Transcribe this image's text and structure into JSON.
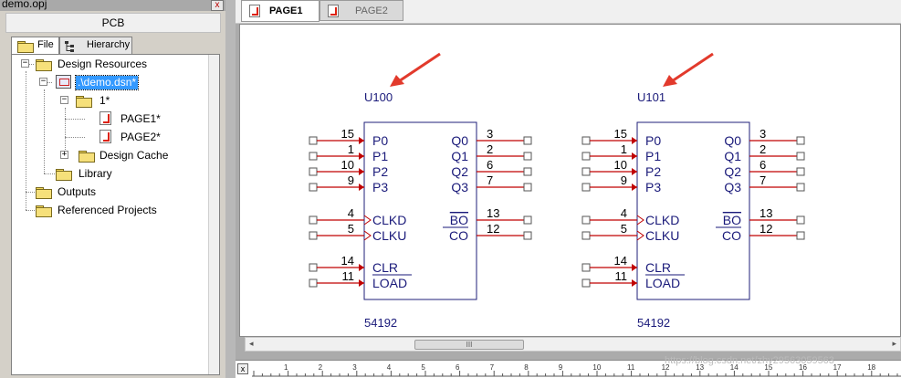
{
  "project": {
    "window_title": "demo.opj",
    "close_glyph": "x",
    "category": "PCB",
    "tabs": [
      {
        "label": "File",
        "icon": "folder-icon"
      },
      {
        "label": "Hierarchy",
        "icon": "hierarchy-icon"
      }
    ],
    "tree": {
      "design_resources": "Design Resources",
      "dsn": ".\\demo.dsn*",
      "schematic_folder": "1*",
      "page1": "PAGE1*",
      "page2": "PAGE2*",
      "design_cache": "Design Cache",
      "library": "Library",
      "outputs": "Outputs",
      "referenced_projects": "Referenced Projects",
      "expand_glyph": "+",
      "collapse_glyph": "−"
    }
  },
  "schematic": {
    "tabs": [
      {
        "label": "PAGE1",
        "active": true
      },
      {
        "label": "PAGE2",
        "active": false
      }
    ],
    "parts": [
      {
        "ref": "U100",
        "value": "54192",
        "inputs_top": [
          {
            "num": "15",
            "name": "P0"
          },
          {
            "num": "1",
            "name": "P1"
          },
          {
            "num": "10",
            "name": "P2"
          },
          {
            "num": "9",
            "name": "P3"
          }
        ],
        "outputs_top": [
          {
            "num": "3",
            "name": "Q0"
          },
          {
            "num": "2",
            "name": "Q1"
          },
          {
            "num": "6",
            "name": "Q2"
          },
          {
            "num": "7",
            "name": "Q3"
          }
        ],
        "clocks": [
          {
            "num": "4",
            "name": "CLKD"
          },
          {
            "num": "5",
            "name": "CLKU"
          }
        ],
        "outputs_mid": [
          {
            "num": "13",
            "name": "BO"
          },
          {
            "num": "12",
            "name": "CO"
          }
        ],
        "control": [
          {
            "num": "14",
            "name": "CLR"
          },
          {
            "num": "11",
            "name": "LOAD"
          }
        ]
      },
      {
        "ref": "U101",
        "value": "54192",
        "inputs_top": [
          {
            "num": "15",
            "name": "P0"
          },
          {
            "num": "1",
            "name": "P1"
          },
          {
            "num": "10",
            "name": "P2"
          },
          {
            "num": "9",
            "name": "P3"
          }
        ],
        "outputs_top": [
          {
            "num": "3",
            "name": "Q0"
          },
          {
            "num": "2",
            "name": "Q1"
          },
          {
            "num": "6",
            "name": "Q2"
          },
          {
            "num": "7",
            "name": "Q3"
          }
        ],
        "clocks": [
          {
            "num": "4",
            "name": "CLKD"
          },
          {
            "num": "5",
            "name": "CLKU"
          }
        ],
        "outputs_mid": [
          {
            "num": "13",
            "name": "BO"
          },
          {
            "num": "12",
            "name": "CO"
          }
        ],
        "control": [
          {
            "num": "14",
            "name": "CLR"
          },
          {
            "num": "11",
            "name": "LOAD"
          }
        ]
      }
    ],
    "scrollbar": {
      "left_arrow": "◂",
      "right_arrow": "▸",
      "thumb_grip": "III"
    },
    "ruler": {
      "close_glyph": "x",
      "ticks": [
        "1",
        "2",
        "3",
        "4",
        "5",
        "6",
        "7",
        "8",
        "9",
        "10",
        "11",
        "12",
        "13",
        "14",
        "15",
        "16",
        "17",
        "18"
      ]
    },
    "watermark": "https://blog.csdn.net/zhy29563059563",
    "colors": {
      "part_outline": "#1f1f7a",
      "pin_line": "#c00000",
      "text": "#1a1a7a",
      "annotation_arrow": "#e23a2c"
    }
  }
}
